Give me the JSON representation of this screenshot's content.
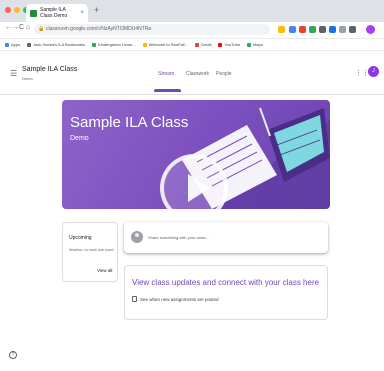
{
  "browser": {
    "tab_title": "Sample ILA Class Demo",
    "tab_close": "×",
    "new_tab": "+",
    "nav": {
      "back": "←",
      "forward": "→",
      "reload": "C",
      "home": "⌂"
    },
    "url": "classroom.google.com/c/NzAyNTI3MDU4NTRa",
    "bookmarks": [
      {
        "label": "Apps",
        "color": "#4285f4"
      },
      {
        "label": "Jack Hanna's ILA Bookmarks",
        "color": "#5f6368"
      },
      {
        "label": "Kindergarten Learn...",
        "color": "#34a853"
      },
      {
        "label": "Welcome to StarFall...",
        "color": "#fbbc04"
      },
      {
        "label": "Gmail",
        "color": "#ea4335"
      },
      {
        "label": "YouTube",
        "color": "#ff0000"
      },
      {
        "label": "Maps",
        "color": "#34a853"
      }
    ]
  },
  "header": {
    "class_name": "Sample ILA Class",
    "class_section": "Demo",
    "tabs": [
      {
        "label": "Stream"
      },
      {
        "label": "Classwork"
      },
      {
        "label": "People"
      }
    ],
    "avatar_initial": "J"
  },
  "banner": {
    "title": "Sample ILA Class",
    "subtitle": "Demo"
  },
  "upcoming": {
    "title": "Upcoming",
    "text": "Woohoo, no work due soon!",
    "view_all": "View all"
  },
  "share": {
    "placeholder": "Share something with your class..."
  },
  "info": {
    "title": "View class updates and connect with your class here",
    "row": "See when new assignments are posted"
  },
  "colors": {
    "accent": "#7248b9",
    "banner": "#7a4fbe"
  }
}
